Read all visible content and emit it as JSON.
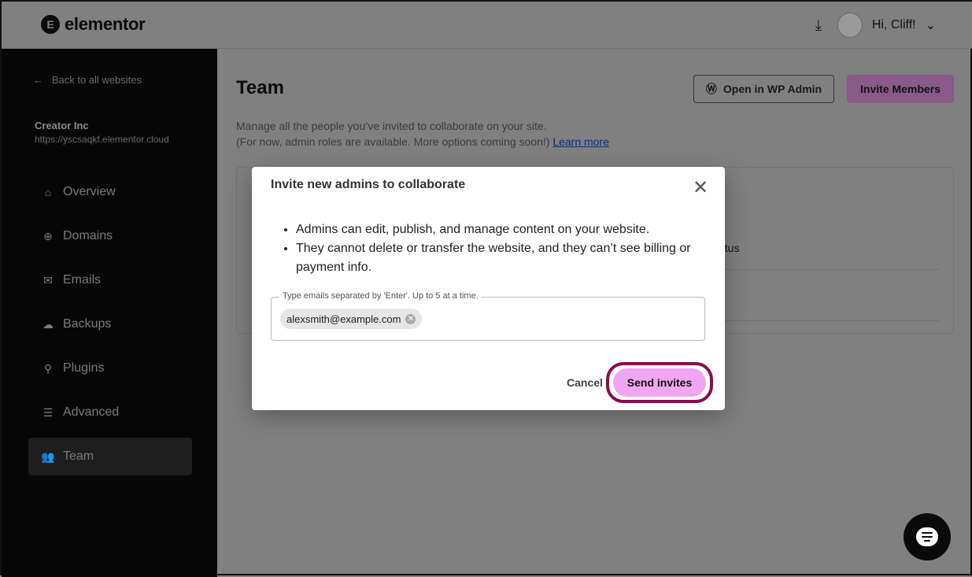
{
  "header": {
    "brand": "elementor",
    "greeting": "Hi, Cliff!",
    "icons": [
      "download-icon",
      "avatar",
      "chevron-down-icon"
    ]
  },
  "sidebar": {
    "back": "Back to all websites",
    "site_name": "Creator Inc",
    "site_url": "https://yscsaqkf.elementor.cloud",
    "items": [
      {
        "label": "Overview",
        "icon": "⌂"
      },
      {
        "label": "Domains",
        "icon": "⊕"
      },
      {
        "label": "Emails",
        "icon": "✉"
      },
      {
        "label": "Backups",
        "icon": "☁"
      },
      {
        "label": "Plugins",
        "icon": "⚲"
      },
      {
        "label": "Advanced",
        "icon": "☰"
      },
      {
        "label": "Team",
        "icon": "👥",
        "active": true
      }
    ]
  },
  "main": {
    "title": "Team",
    "desc1": "Manage all the people you’ve invited to collaborate on your site.",
    "desc2": "(For now, admin roles are available. More options coming soon!)",
    "learn_more": "Learn more",
    "open_wp": "Open in WP Admin",
    "invite_members": "Invite Members",
    "status_col": "atus"
  },
  "modal": {
    "title": "Invite new admins to collaborate",
    "bullets": [
      "Admins can edit, publish, and manage content on your website.",
      "They cannot delete or transfer the website, and they can’t see billing or payment info."
    ],
    "field_label": "Type emails separated by 'Enter'. Up to 5 at a time.",
    "chip": "alexsmith@example.com",
    "cancel": "Cancel",
    "send": "Send invites"
  },
  "colors": {
    "send_button": "#f0a6f0",
    "highlight_ring": "#8b0b4e",
    "sidebar": "#060606"
  }
}
